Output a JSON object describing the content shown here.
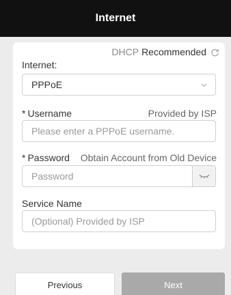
{
  "header": {
    "title": "Internet"
  },
  "dhcp": {
    "prefix": "DHCP",
    "label": "Recommended"
  },
  "internet": {
    "label": "Internet:",
    "selected": "PPPoE"
  },
  "username": {
    "required_mark": "*",
    "label": "Username",
    "hint": "Provided by ISP",
    "placeholder": "Please enter a PPPoE username."
  },
  "password": {
    "required_mark": "*",
    "label": "Password",
    "hint": "Obtain Account from Old Device",
    "placeholder": "Password"
  },
  "service_name": {
    "label": "Service Name",
    "placeholder": "(Optional) Provided by ISP"
  },
  "buttons": {
    "previous": "Previous",
    "next": "Next"
  },
  "icons": {
    "refresh": "refresh-icon",
    "dropdown": "chevron-down-icon",
    "password_toggle": "eye-closed-icon"
  }
}
